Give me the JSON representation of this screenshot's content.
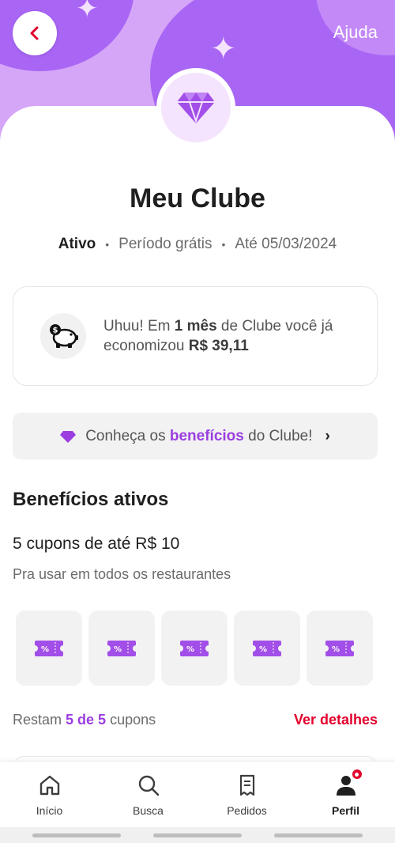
{
  "header": {
    "back_icon": "chevron-left-icon",
    "help_label": "Ajuda",
    "badge_icon": "diamond-icon"
  },
  "title": "Meu Clube",
  "status": {
    "state": "Ativo",
    "plan": "Período grátis",
    "until": "Até 05/03/2024"
  },
  "savings": {
    "icon": "piggy-bank-icon",
    "prefix": "Uhuu! Em ",
    "period": "1 mês",
    "middle": " de Clube você já economizou ",
    "amount": "R$ 39,11"
  },
  "benefits_banner": {
    "icon": "diamond-icon",
    "prefix": "Conheça os ",
    "highlight": "benefícios",
    "suffix": " do Clube!",
    "chevron": "›"
  },
  "active_benefits": {
    "title": "Benefícios ativos",
    "coupon_title": "5 cupons de até R$ 10",
    "coupon_subtitle": "Pra usar em todos os restaurantes",
    "coupons": [
      {
        "label": "%",
        "icon": "coupon-ticket-icon"
      },
      {
        "label": "%",
        "icon": "coupon-ticket-icon"
      },
      {
        "label": "%",
        "icon": "coupon-ticket-icon"
      },
      {
        "label": "%",
        "icon": "coupon-ticket-icon"
      },
      {
        "label": "%",
        "icon": "coupon-ticket-icon"
      }
    ],
    "remaining_prefix": "Restam ",
    "remaining_count": "5 de 5",
    "remaining_suffix": " cupons",
    "details_label": "Ver detalhes"
  },
  "nav": {
    "items": [
      {
        "label": "Início",
        "icon": "home-icon"
      },
      {
        "label": "Busca",
        "icon": "search-icon"
      },
      {
        "label": "Pedidos",
        "icon": "orders-icon"
      },
      {
        "label": "Perfil",
        "icon": "profile-icon"
      }
    ]
  },
  "colors": {
    "accent_purple": "#9b3ee0",
    "link_red": "#e3002c",
    "hero_light": "#d5a6f7",
    "hero_dark": "#a965f4"
  }
}
